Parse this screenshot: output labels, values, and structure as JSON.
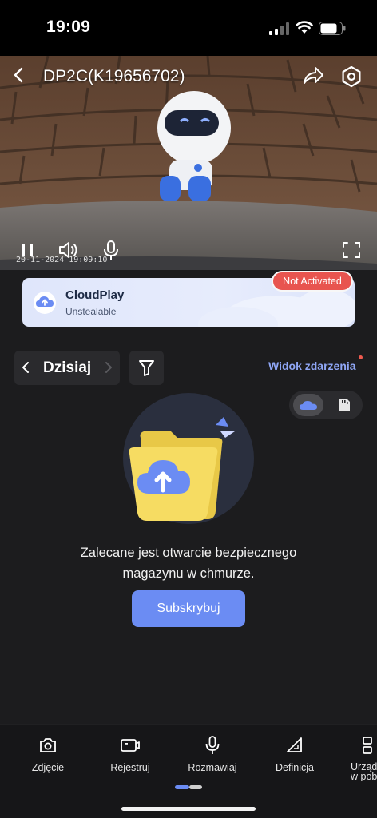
{
  "status_bar": {
    "time": "19:09"
  },
  "header": {
    "title": "DP2C(K19656702)"
  },
  "video": {
    "timestamp": "20-11-2024 19:09:10"
  },
  "cloud_banner": {
    "title": "CloudPlay",
    "subtitle": "Unstealable",
    "status_badge": "Not Activated"
  },
  "date_nav": {
    "label": "Dzisiaj"
  },
  "event_view_label": "Widok zdarzenia",
  "empty_state": {
    "message_line1": "Zalecane jest otwarcie bezpiecznego",
    "message_line2": "magazynu w chmurze.",
    "button_label": "Subskrybuj"
  },
  "toolbar": {
    "items": [
      {
        "label": "Zdjęcie",
        "icon": "camera-icon"
      },
      {
        "label": "Rejestruj",
        "icon": "video-record-icon"
      },
      {
        "label": "Rozmawiaj",
        "icon": "microphone-icon"
      },
      {
        "label": "Definicja",
        "icon": "definition-icon"
      },
      {
        "label": "Urządzenia",
        "label_line2": "w pobliżu",
        "icon": "devices-icon"
      }
    ]
  },
  "colors": {
    "accent": "#6b8cf3",
    "badge": "#e8544f",
    "background": "#1c1c1e",
    "link": "#8fa6f5"
  }
}
